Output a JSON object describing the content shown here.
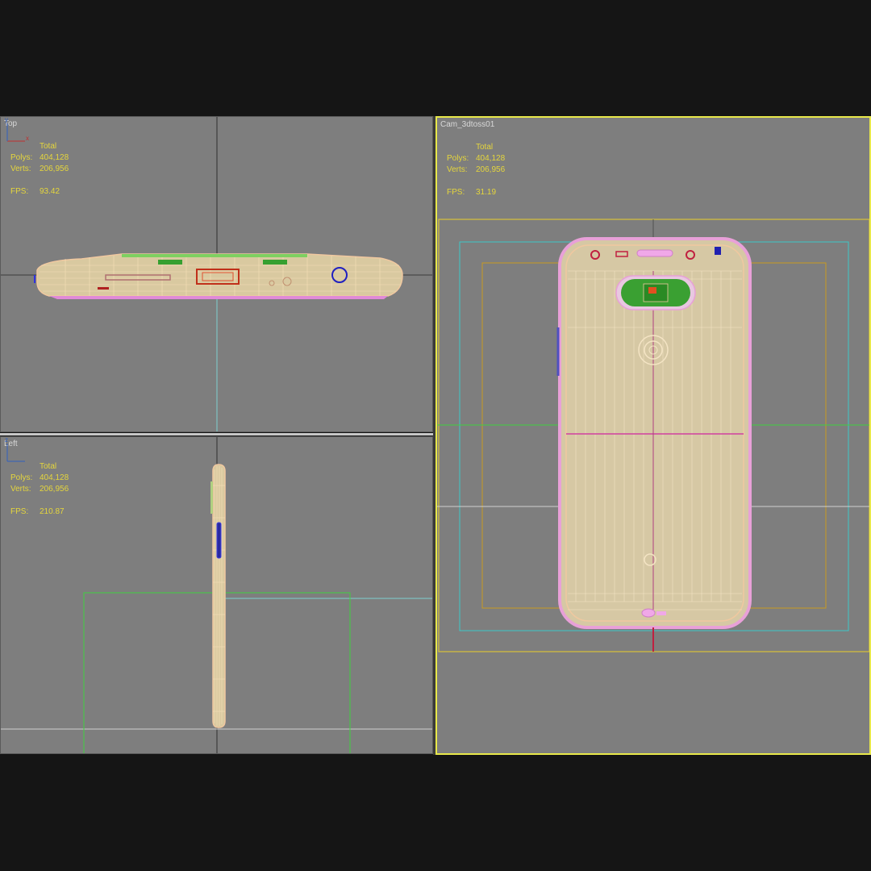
{
  "viewports": {
    "top": {
      "label": "Top",
      "total_label": "Total",
      "polys_label": "Polys:",
      "polys": "404,128",
      "verts_label": "Verts:",
      "verts": "206,956",
      "fps_label": "FPS:",
      "fps": "93.42"
    },
    "left": {
      "label": "Left",
      "total_label": "Total",
      "polys_label": "Polys:",
      "polys": "404,128",
      "verts_label": "Verts:",
      "verts": "206,956",
      "fps_label": "FPS:",
      "fps": "210.87"
    },
    "camera": {
      "label": "Cam_3dtoss01",
      "total_label": "Total",
      "polys_label": "Polys:",
      "polys": "404,128",
      "verts_label": "Verts:",
      "verts": "206,956",
      "fps_label": "FPS:",
      "fps": "31.19"
    }
  },
  "colors": {
    "viewport_bg": "#7e7e7e",
    "active_border": "#e8e84a",
    "stats_text": "#e5d63c",
    "wire_body": "#f0c8a0",
    "wire_edge": "#e89ad8",
    "wire_green": "#b0f090"
  }
}
